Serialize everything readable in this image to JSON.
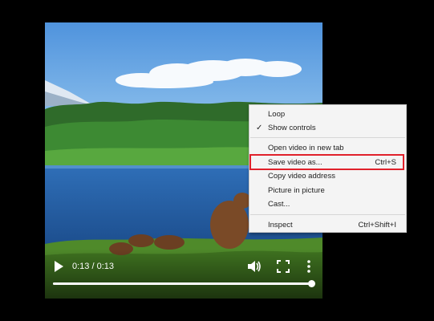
{
  "player": {
    "time_display": "0:13 / 0:13",
    "progress_fraction": 1.0,
    "icons": {
      "play": "play-icon",
      "volume": "volume-icon",
      "fullscreen": "fullscreen-icon",
      "more": "more-vertical-icon"
    }
  },
  "context_menu": {
    "items": [
      {
        "label": "Loop",
        "shortcut": "",
        "checked": false
      },
      {
        "label": "Show controls",
        "shortcut": "",
        "checked": true
      },
      {
        "label": "Open video in new tab",
        "shortcut": ""
      },
      {
        "label": "Save video as...",
        "shortcut": "Ctrl+S",
        "highlighted": true
      },
      {
        "label": "Copy video address",
        "shortcut": ""
      },
      {
        "label": "Picture in picture",
        "shortcut": ""
      },
      {
        "label": "Cast...",
        "shortcut": ""
      },
      {
        "label": "Inspect",
        "shortcut": "Ctrl+Shift+I"
      }
    ],
    "check_glyph": "✓",
    "highlight_color": "#e0212b"
  }
}
